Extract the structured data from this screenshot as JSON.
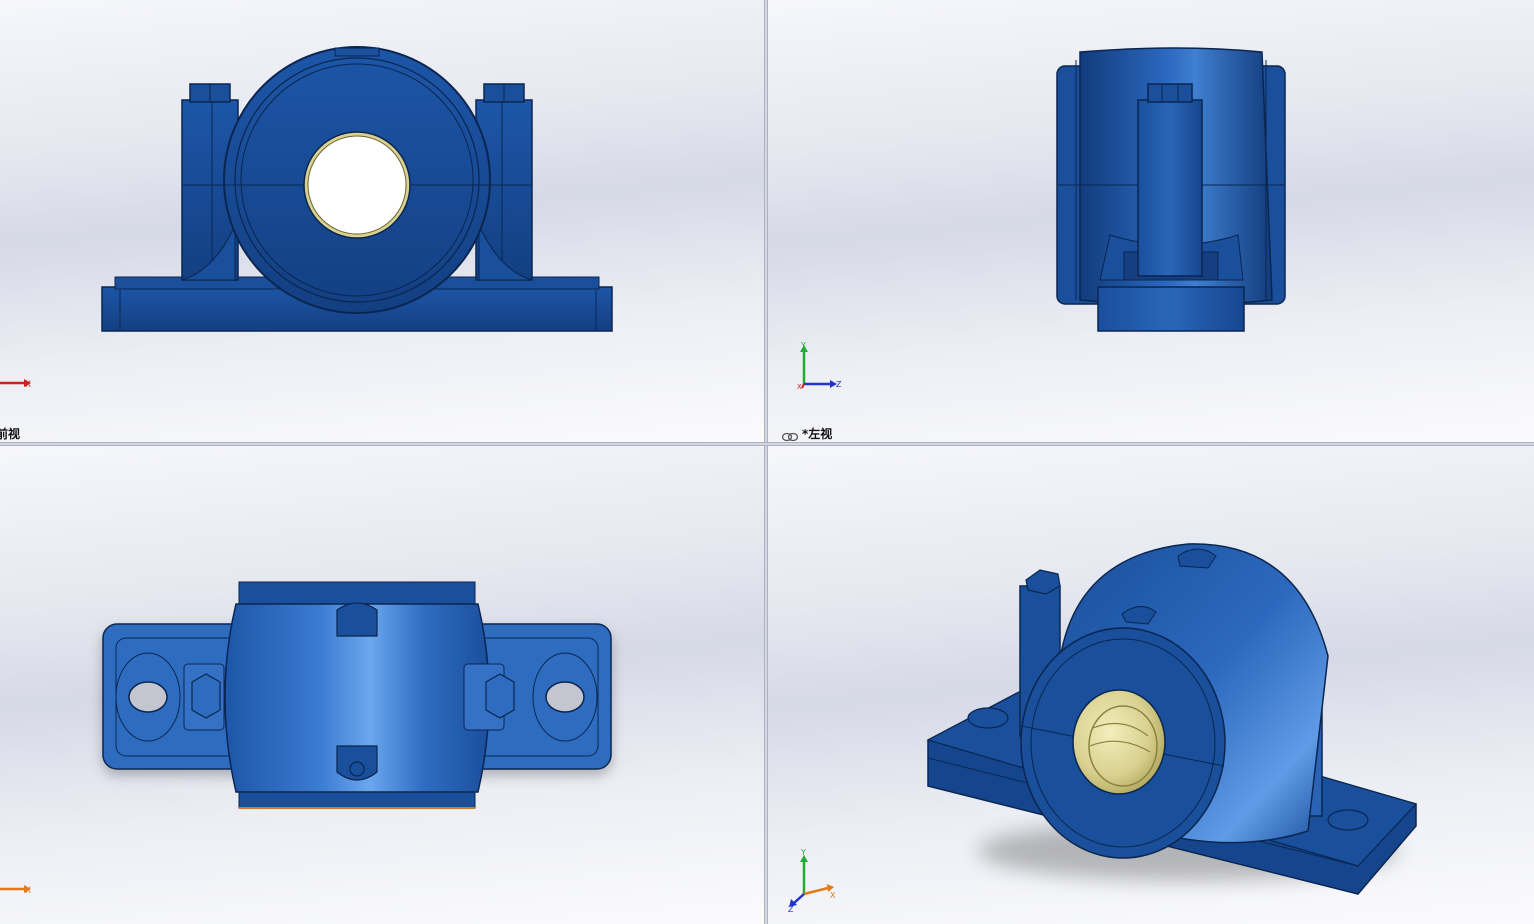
{
  "viewports": {
    "front": {
      "label": "前视"
    },
    "left": {
      "label": "*左视"
    },
    "top": {
      "label": ""
    },
    "iso": {
      "label": ""
    }
  },
  "triad": {
    "x": "X",
    "y": "Y",
    "z": "Z"
  },
  "colors": {
    "part_blue": "#1a4f9c",
    "part_dark": "#0f3470",
    "bushing": "#d9d190",
    "axis_x": "#cc2222",
    "axis_y": "#22aa33",
    "axis_z": "#2233cc",
    "axis_x_iso": "#e07a1a"
  },
  "icons": [
    "link-icon"
  ]
}
